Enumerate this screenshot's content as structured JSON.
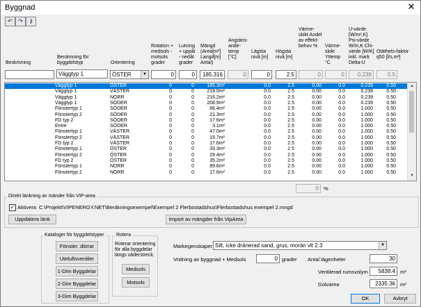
{
  "window": {
    "title": "Byggnad",
    "close_glyph": "✕"
  },
  "toolbar": {
    "icons": [
      "undo-icon",
      "redo-icon",
      "key-icon"
    ],
    "glyphs": [
      "↶",
      "↷",
      "⚷"
    ]
  },
  "headers": {
    "beskrivning": "Beskrivning",
    "benamning": "Benämning för byggdelstyp",
    "orientering": "Orientering",
    "rotation": "Rotation + medsols - motsols grader",
    "lutning": "Lutning + uppåt - nedåt grader",
    "mangd": "Mängd (Area[m²] Langd[m] Antal)",
    "angransande": "Angräns-ande-temp [°C]",
    "lagsta": "Lägsta nivå [m]",
    "hogsta": "Högsta nivå [m]",
    "varmeskikt_andel": "Värme-skikt Andel av effekt-behov %",
    "varmeskikt_yttemp": "Värme-skikt Yttemp °C",
    "uvarde": "U-värde [W/m²,K] Psi-värde W/m,K Chi-värde [W/K] inkl. mark Delta-U",
    "otathet": "Otäthets-faktor q50 [l/s,m²]"
  },
  "edit_row": {
    "beskrivning": "",
    "benamning": "Väggtyp 1",
    "orientering": "ÖSTER",
    "rotation": "0",
    "lutning": "0",
    "mangd": "185.316",
    "angransande": "0",
    "lagsta": "0",
    "hogsta": "2.5",
    "varmeskikt_andel": "0",
    "varmeskikt_yttemp": "0",
    "uvarde": "0.239",
    "otathet": "0.5"
  },
  "rows": [
    [
      "Väggtyp 1",
      "ÖSTER",
      "0",
      "0",
      "185.3m²",
      "0.0",
      "2.5",
      "0.00",
      "0.0",
      "0.239",
      "0.50"
    ],
    [
      "Väggtyp 1",
      "VÄSTER",
      "0",
      "0",
      "219.0m²",
      "0.0",
      "2.5",
      "0.00",
      "0.0",
      "0.239",
      "0.50"
    ],
    [
      "Väggtyp 1",
      "NORR",
      "0",
      "0",
      "216.2m²",
      "0.0",
      "2.5",
      "0.00",
      "0.0",
      "0.239",
      "0.50"
    ],
    [
      "Väggtyp 1",
      "SÖDER",
      "0",
      "0",
      "208.9m²",
      "0.0",
      "2.5",
      "0.00",
      "0.0",
      "0.239",
      "0.50"
    ],
    [
      "Fönstertyp 1",
      "SÖDER",
      "0",
      "0",
      "66.4m²",
      "0.0",
      "2.5",
      "0.00",
      "0.0",
      "1.000",
      "0.50"
    ],
    [
      "Fönstertyp 2",
      "SÖDER",
      "0",
      "0",
      "21.3m²",
      "0.0",
      "2.5",
      "0.00",
      "0.0",
      "1.000",
      "0.50"
    ],
    [
      "FD typ 2",
      "SÖDER",
      "0",
      "0",
      "17.6m²",
      "0.0",
      "2.5",
      "0.00",
      "0.0",
      "1.000",
      "0.50"
    ],
    [
      "Entre",
      "SÖDER",
      "0",
      "0",
      "3.1m²",
      "0.0",
      "2.5",
      "0.00",
      "0.0",
      "2.000",
      "0.50"
    ],
    [
      "Fönstertyp 1",
      "VÄSTER",
      "0",
      "0",
      "47.0m²",
      "0.0",
      "2.5",
      "0.00",
      "0.0",
      "1.000",
      "0.50"
    ],
    [
      "Fönstertyp 2",
      "VÄSTER",
      "0",
      "0",
      "15.7m²",
      "0.0",
      "2.5",
      "0.00",
      "0.0",
      "1.000",
      "0.50"
    ],
    [
      "FD typ 2",
      "VÄSTER",
      "0",
      "0",
      "17.6m²",
      "0.0",
      "2.5",
      "0.00",
      "0.0",
      "1.000",
      "0.50"
    ],
    [
      "Fönstertyp 1",
      "ÖSTER",
      "0",
      "0",
      "33.3m²",
      "0.0",
      "2.5",
      "0.00",
      "0.0",
      "1.000",
      "0.50"
    ],
    [
      "Fönstertyp 2",
      "ÖSTER",
      "0",
      "0",
      "29.4m²",
      "0.0",
      "2.5",
      "0.00",
      "0.0",
      "1.000",
      "0.50"
    ],
    [
      "FD typ 2",
      "ÖSTER",
      "0",
      "0",
      "35.2m²",
      "0.0",
      "2.5",
      "0.00",
      "0.0",
      "1.000",
      "0.50"
    ],
    [
      "Fönstertyp 1",
      "NORR",
      "0",
      "0",
      "89.6m²",
      "0.0",
      "2.5",
      "0.00",
      "0.0",
      "1.000",
      "0.50"
    ],
    [
      "Fönstertyp 2",
      "NORR",
      "0",
      "0",
      "17.6m²",
      "0.0",
      "2.5",
      "0.00",
      "0.0",
      "1.000",
      "0.50"
    ]
  ],
  "percent_total": {
    "value": "0",
    "unit": "%"
  },
  "vip": {
    "group_title": "Direkt länkning av mänder från VIP-area",
    "checkbox_label": "Aktivera",
    "checked": true,
    "path": "C:\\Projekt\\VIPENERGY.NET\\Beräkningsexempel\\Exempel 2 Flerbostadshus\\Flerbostadshus exempel 2.mngd",
    "update_button": "Uppdatera länk",
    "import_button": "Import av mängder från VipArea"
  },
  "kataloger": {
    "title": "Kataloger för byggdelstyper",
    "buttons": [
      "Fönster, dörrar",
      "Uteluftsventiler",
      "1-Dim Byggdelar",
      "2-Dim Byggdelar",
      "3-Dim Byggdelar"
    ]
  },
  "rotera": {
    "title": "Rotera",
    "description": "Roterar orientering för alla byggdelar längs väderstreck.",
    "medsols": "Medsols",
    "motsols": "Motsols"
  },
  "settings": {
    "markegenskaper_label": "Markegenskaper",
    "markegenskaper_value": "Silt, icke dränerad sand, grus, morän vlt 2.3",
    "vridning_label": "Vridning av byggnad + Medsols",
    "vridning_value": "0",
    "vridning_unit": "grader",
    "antal_label": "Antal lägenheter",
    "antal_value": "30",
    "ventilerad_label": "Ventilerad rumsvolym",
    "ventilerad_value": "5838.4",
    "ventilerad_unit": "m³",
    "golvarea_label": "Golvarea",
    "golvarea_value": "2335.36",
    "golvarea_unit": "m²"
  },
  "footer": {
    "ok": "OK",
    "cancel": "Avbryt"
  }
}
